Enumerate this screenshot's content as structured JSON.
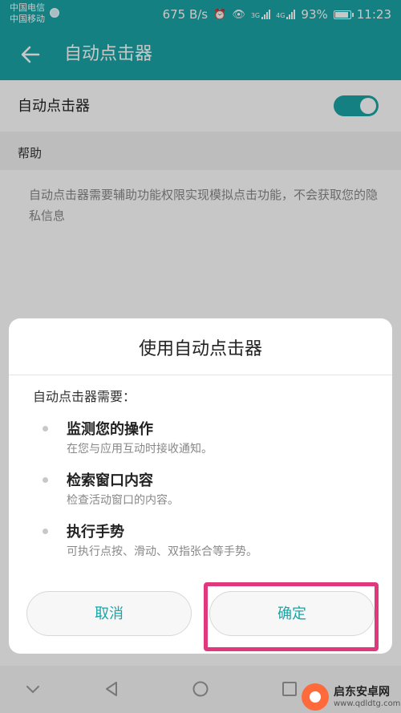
{
  "status": {
    "carrier_line1": "中国电信",
    "carrier_line2": "中国移动",
    "speed": "675 B/s",
    "alarm_icon": "alarm-icon",
    "eye_icon": "eye-icon",
    "net1": "3G",
    "net2": "4G",
    "battery": "93%",
    "time": "11:23"
  },
  "appbar": {
    "title": "自动点击器",
    "back_icon": "back-arrow-icon"
  },
  "settings": {
    "toggle_label": "自动点击器",
    "toggle_on": true,
    "section_help": "帮助",
    "help_text": "自动点击器需要辅助功能权限实现模拟点击功能，不会获取您的隐私信息"
  },
  "dialog": {
    "title": "使用自动点击器",
    "intro": "自动点击器需要：",
    "permissions": [
      {
        "title": "监测您的操作",
        "desc": "在您与应用互动时接收通知。"
      },
      {
        "title": "检索窗口内容",
        "desc": "检查活动窗口的内容。"
      },
      {
        "title": "执行手势",
        "desc": "可执行点按、滑动、双指张合等手势。"
      }
    ],
    "cancel_label": "取消",
    "ok_label": "确定"
  },
  "watermark": {
    "name": "启东安卓网",
    "url": "www.qdldtg.com"
  },
  "colors": {
    "accent": "#1aa5a7",
    "highlight": "#e0387d"
  }
}
